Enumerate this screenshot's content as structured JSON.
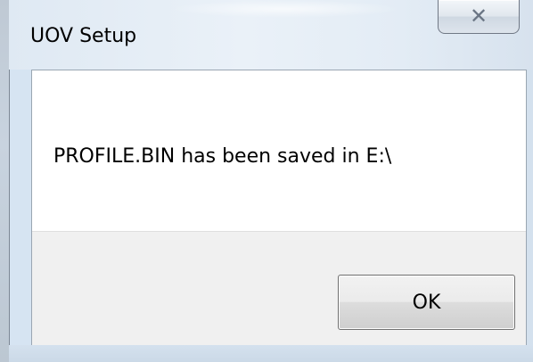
{
  "window": {
    "title": "UOV Setup",
    "close_icon": "close-icon"
  },
  "dialog": {
    "message": "PROFILE.BIN has been saved in E:\\",
    "ok_label": "OK"
  },
  "colors": {
    "frame": "#d6e4f2",
    "button_bar": "#f0f0f0",
    "client": "#ffffff"
  }
}
